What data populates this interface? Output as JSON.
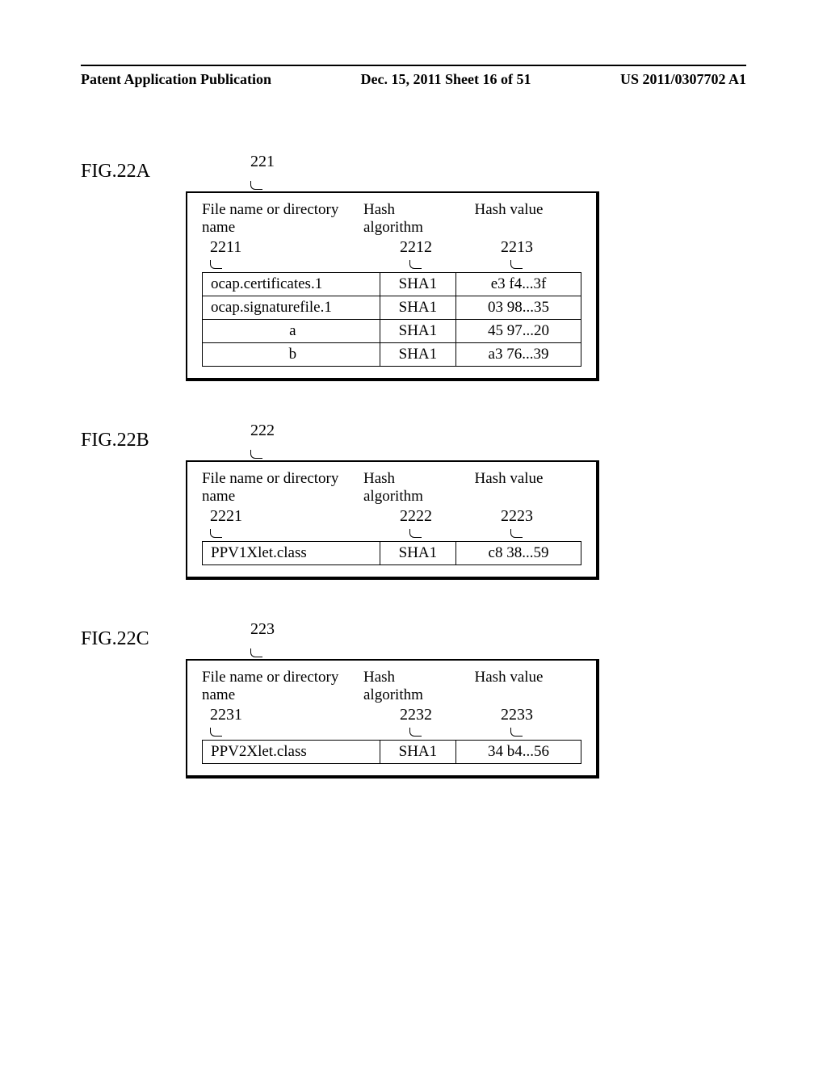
{
  "header": {
    "left": "Patent Application Publication",
    "center": "Dec. 15, 2011  Sheet 16 of 51",
    "right": "US 2011/0307702 A1"
  },
  "figA": {
    "label": "FIG.22A",
    "box_ref": "221",
    "col1_header": "File name or directory name",
    "col2_header": "Hash algorithm",
    "col3_header": "Hash value",
    "sub1": "2211",
    "sub2": "2212",
    "sub3": "2213",
    "rows": [
      {
        "name": "ocap.certificates.1",
        "algo": "SHA1",
        "val": "e3 f4...3f"
      },
      {
        "name": "ocap.signaturefile.1",
        "algo": "SHA1",
        "val": "03 98...35"
      },
      {
        "name": "a",
        "algo": "SHA1",
        "val": "45 97...20"
      },
      {
        "name": "b",
        "algo": "SHA1",
        "val": "a3 76...39"
      }
    ]
  },
  "figB": {
    "label": "FIG.22B",
    "box_ref": "222",
    "col1_header": "File name or directory name",
    "col2_header": "Hash algorithm",
    "col3_header": "Hash value",
    "sub1": "2221",
    "sub2": "2222",
    "sub3": "2223",
    "rows": [
      {
        "name": "PPV1Xlet.class",
        "algo": "SHA1",
        "val": "c8 38...59"
      }
    ]
  },
  "figC": {
    "label": "FIG.22C",
    "box_ref": "223",
    "col1_header": "File name or directory name",
    "col2_header": "Hash algorithm",
    "col3_header": "Hash value",
    "sub1": "2231",
    "sub2": "2232",
    "sub3": "2233",
    "rows": [
      {
        "name": "PPV2Xlet.class",
        "algo": "SHA1",
        "val": "34 b4...56"
      }
    ]
  }
}
